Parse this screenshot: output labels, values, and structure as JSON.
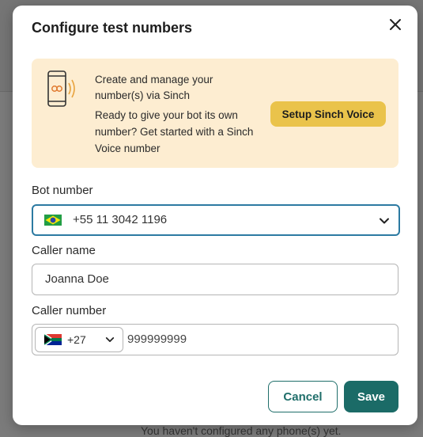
{
  "background": {
    "text": "You haven't configured any phone(s) yet."
  },
  "dialog": {
    "title": "Configure test numbers",
    "close_icon": "close-icon"
  },
  "banner": {
    "icon": "smartphone-voice-icon",
    "line1": "Create and manage your number(s) via Sinch",
    "line2": "Ready to give your bot its own number? Get started with a Sinch Voice number",
    "button_label": "Setup Sinch Voice"
  },
  "bot_number": {
    "label": "Bot number",
    "flag": "brazil-flag-icon",
    "value": "+55 11 3042 1196"
  },
  "caller_name": {
    "label": "Caller name",
    "value": "Joanna Doe"
  },
  "caller_number": {
    "label": "Caller number",
    "country_flag": "south-africa-flag-icon",
    "country_code": "+27",
    "value": "999999999"
  },
  "actions": {
    "cancel_label": "Cancel",
    "save_label": "Save"
  },
  "colors": {
    "accent": "#1b6b67",
    "banner_bg": "#fdedd1",
    "setup_button": "#eac34b",
    "focus_border": "#2c7aa2"
  }
}
